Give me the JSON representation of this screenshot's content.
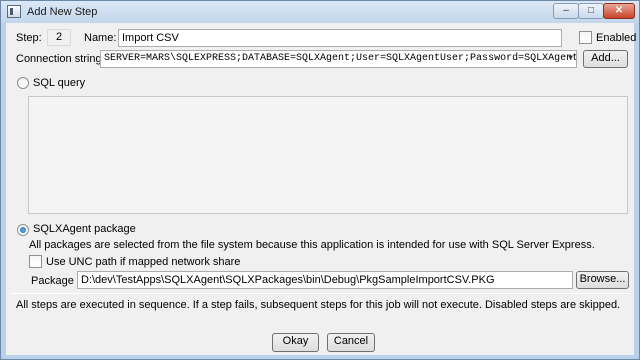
{
  "window": {
    "title": "Add New Step",
    "buttons": {
      "minimize": "–",
      "maximize": "□",
      "close": "✕"
    }
  },
  "step": {
    "label": "Step:",
    "value": "2"
  },
  "name": {
    "label": "Name:",
    "value": "Import CSV"
  },
  "enabled": {
    "label": "Enabled",
    "checked": false
  },
  "connection": {
    "label": "Connection string",
    "value": "SERVER=MARS\\SQLEXPRESS;DATABASE=SQLXAgent;User=SQLXAgentUser;Password=SQLXAgent",
    "add_button": "Add..."
  },
  "sql_query": {
    "label": "SQL query",
    "selected": false,
    "text": ""
  },
  "package_option": {
    "label": "SQLXAgent package",
    "selected": true,
    "description": "All packages are selected from the file system because this application is intended for use with SQL Server Express."
  },
  "unc": {
    "label": "Use UNC path if mapped network share",
    "checked": false
  },
  "package": {
    "label": "Package",
    "value": "D:\\dev\\TestApps\\SQLXAgent\\SQLXPackages\\bin\\Debug\\PkgSampleImportCSV.PKG",
    "browse_button": "Browse..."
  },
  "note": "All steps are executed in sequence. If a step fails, subsequent steps for this job will not execute. Disabled steps are skipped.",
  "footer": {
    "okay": "Okay",
    "cancel": "Cancel"
  }
}
